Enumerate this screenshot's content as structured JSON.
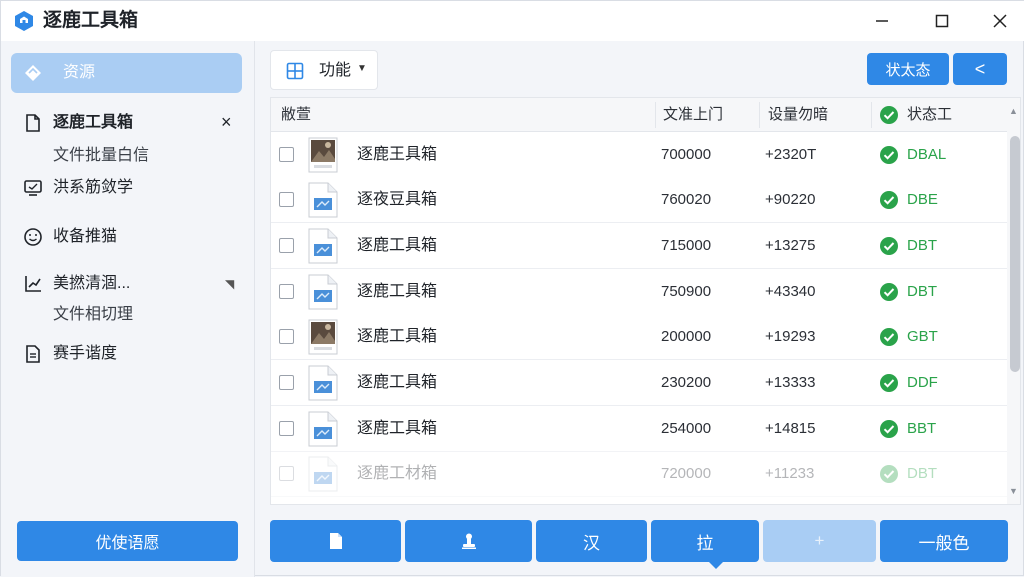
{
  "window": {
    "title": "逐鹿工具箱",
    "controls": {
      "minimize": "—",
      "maximize": "☐",
      "close": "✕"
    }
  },
  "sidebar": {
    "active_item": {
      "label": "资源",
      "icon": "diamond-icon"
    },
    "items": [
      {
        "label": "逐鹿工具箱",
        "icon": "file-icon",
        "sub": "文件批量白信",
        "close": "×"
      },
      {
        "label": "洪系筋敛学",
        "icon": "monitor-icon"
      },
      {
        "label": "收备推猫",
        "icon": "smile-icon"
      },
      {
        "label": "美撚清涸...",
        "icon": "chart-icon",
        "sub": "文件相切理"
      },
      {
        "label": "赛手谐度",
        "icon": "document-icon"
      }
    ],
    "bottom_button": "优使语愿"
  },
  "toolbar": {
    "function_label": "功能",
    "status_label": "状太态",
    "back_label": "<"
  },
  "table": {
    "columns": [
      "敝萱",
      "文准上门",
      "设量勿暗",
      "状态工"
    ],
    "rows": [
      {
        "name": "逐鹿王具箱",
        "size": "700000",
        "delta": "+2320T",
        "status": "DBAL",
        "thumb": "photo"
      },
      {
        "name": "逐夜豆具箱",
        "size": "760020",
        "delta": "+90220",
        "status": "DBE",
        "thumb": "file"
      },
      {
        "name": "逐鹿工具箱",
        "size": "715000",
        "delta": "+13275",
        "status": "DBT",
        "thumb": "file"
      },
      {
        "name": "逐鹿工具箱",
        "size": "750900",
        "delta": "+43340",
        "status": "DBT",
        "thumb": "file"
      },
      {
        "name": "逐鹿工具箱",
        "size": "200000",
        "delta": "+19293",
        "status": "GBT",
        "thumb": "photo"
      },
      {
        "name": "逐鹿工具箱",
        "size": "230200",
        "delta": "+13333",
        "status": "DDF",
        "thumb": "file"
      },
      {
        "name": "逐鹿工具箱",
        "size": "254000",
        "delta": "+14815",
        "status": "BBT",
        "thumb": "file"
      },
      {
        "name": "逐鹿工材箱",
        "size": "720000",
        "delta": "+11233",
        "status": "DBT",
        "thumb": "file"
      }
    ]
  },
  "bottom_buttons": [
    {
      "label": "",
      "icon": "file-icon"
    },
    {
      "label": "",
      "icon": "stamp-icon"
    },
    {
      "label": "汉",
      "icon": ""
    },
    {
      "label": "拉",
      "icon": ""
    },
    {
      "label": "+",
      "icon": ""
    },
    {
      "label": "一般色",
      "icon": ""
    }
  ],
  "colors": {
    "accent": "#2f88e6",
    "sidebar_active": "#aacdf3",
    "status_ok": "#2aa34a"
  }
}
